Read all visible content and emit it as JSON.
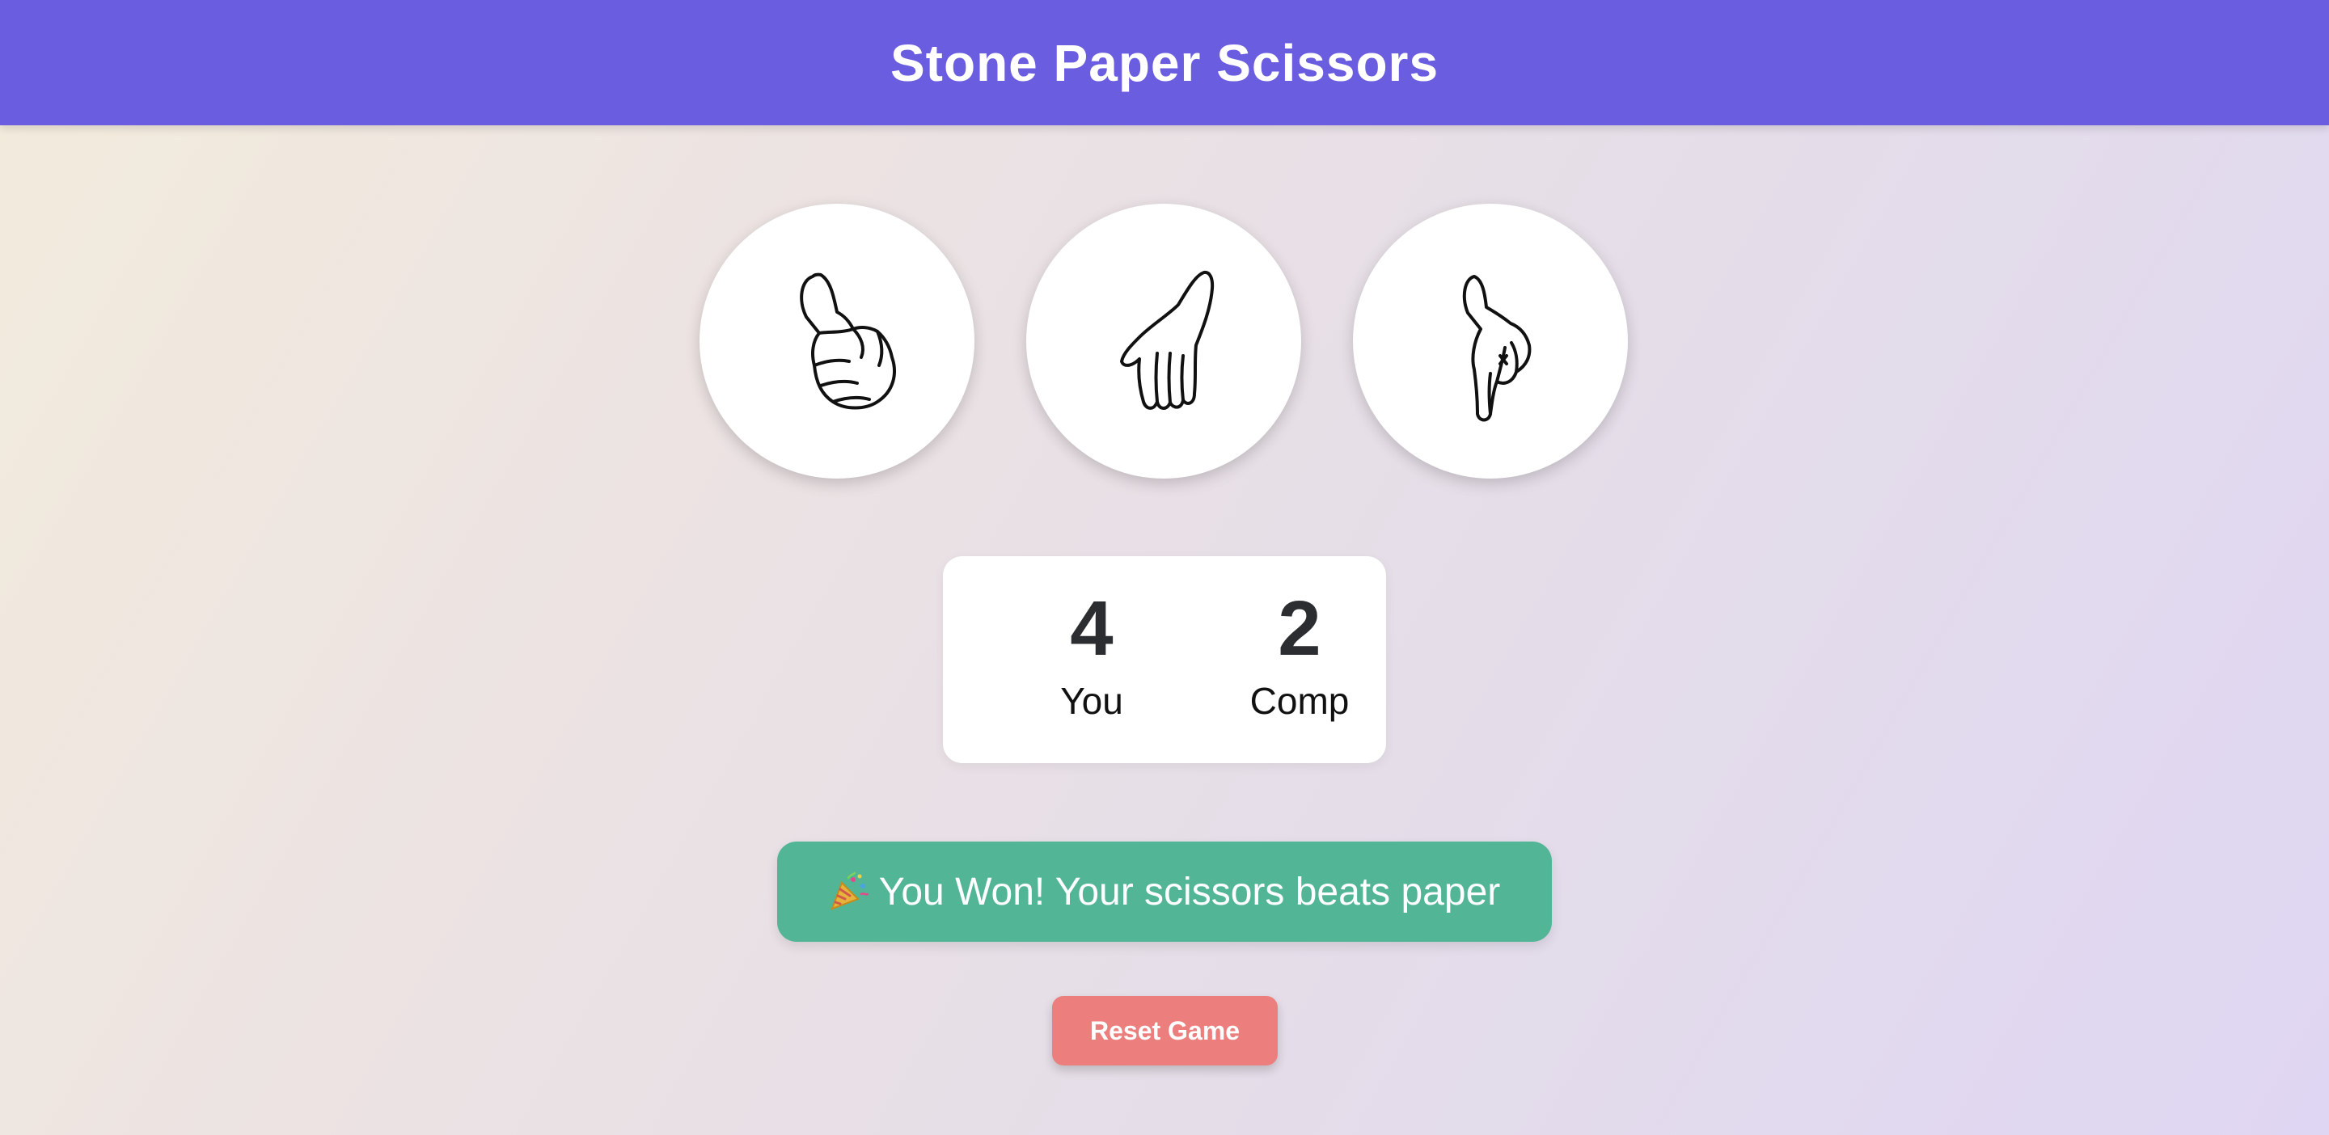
{
  "header": {
    "title": "Stone Paper Scissors"
  },
  "choices": [
    {
      "id": "rock",
      "icon": "fist-hand-icon"
    },
    {
      "id": "paper",
      "icon": "open-hand-icon"
    },
    {
      "id": "scissors",
      "icon": "two-finger-hand-icon"
    }
  ],
  "scoreboard": {
    "user": {
      "score": "4",
      "label": "You"
    },
    "comp": {
      "score": "2",
      "label": "Comp"
    }
  },
  "message": {
    "icon": "party-popper-icon",
    "text": "You Won! Your scissors beats paper",
    "color": "#52b596"
  },
  "reset": {
    "label": "Reset Game",
    "color": "#ec7f7d"
  },
  "theme": {
    "accent": "#6a5de0"
  }
}
